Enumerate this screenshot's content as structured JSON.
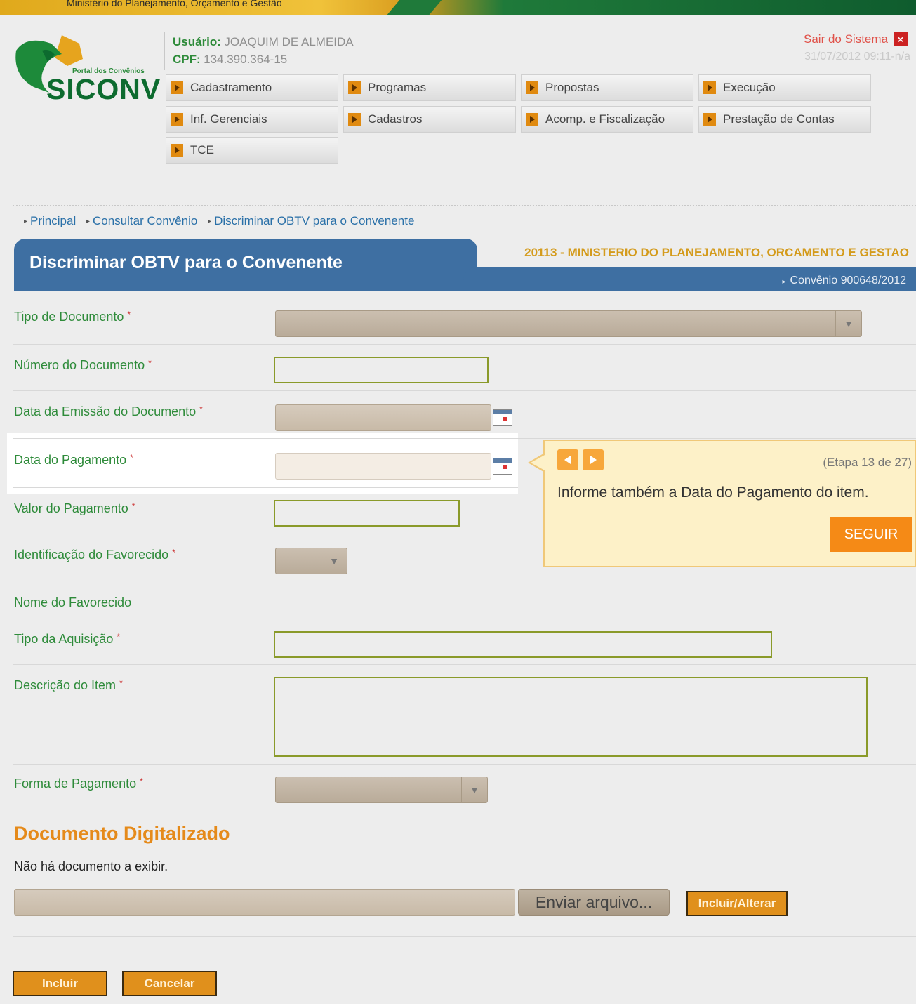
{
  "top_banner": {
    "text": "Ministério do Planejamento, Orçamento e Gestão"
  },
  "logo": {
    "portal": "Portal dos Convênios",
    "name": "SICONV"
  },
  "user": {
    "user_label": "Usuário:",
    "user_name": "JOAQUIM DE ALMEIDA",
    "cpf_label": "CPF:",
    "cpf_value": "134.390.364-15",
    "logout": "Sair do Sistema",
    "datetime": "31/07/2012 09:11-n/a"
  },
  "menu": [
    {
      "label": "Cadastramento"
    },
    {
      "label": "Programas"
    },
    {
      "label": "Propostas"
    },
    {
      "label": "Execução"
    },
    {
      "label": "Inf. Gerenciais"
    },
    {
      "label": "Cadastros"
    },
    {
      "label": "Acomp. e Fiscalização"
    },
    {
      "label": "Prestação de Contas"
    },
    {
      "label": "TCE"
    }
  ],
  "breadcrumb": [
    "Principal",
    "Consultar Convênio",
    "Discriminar OBTV para o Convenente"
  ],
  "page": {
    "title": "Discriminar OBTV para o Convenente",
    "ministry": "20113 - MINISTERIO DO PLANEJAMENTO, ORCAMENTO E GESTAO",
    "convenio": "Convênio 900648/2012"
  },
  "form": {
    "tipo_documento": "Tipo de Documento",
    "numero_documento": "Número do Documento",
    "data_emissao": "Data da Emissão do Documento",
    "data_pagamento": "Data do Pagamento",
    "valor_pagamento": "Valor do Pagamento",
    "identificacao_favorecido": "Identificação do Favorecido",
    "nome_favorecido": "Nome do Favorecido",
    "tipo_aquisicao": "Tipo da Aquisição",
    "descricao_item": "Descrição do Item",
    "forma_pagamento": "Forma de Pagamento",
    "required_mark": "*"
  },
  "tooltip": {
    "step": "(Etapa 13 de 27)",
    "text": "Informe também a Data do Pagamento do item.",
    "button": "SEGUIR"
  },
  "documento_digitalizado": {
    "title": "Documento Digitalizado",
    "empty": "Não há documento a exibir.",
    "file_button": "Enviar arquivo...",
    "include_button": "Incluir/Alterar"
  },
  "actions": {
    "incluir": "Incluir",
    "cancelar": "Cancelar"
  },
  "colors": {
    "brand_green": "#0d6b2f",
    "label_green": "#2e8b3a",
    "title_blue": "#3e6fa2",
    "accent_orange": "#e0901c"
  }
}
